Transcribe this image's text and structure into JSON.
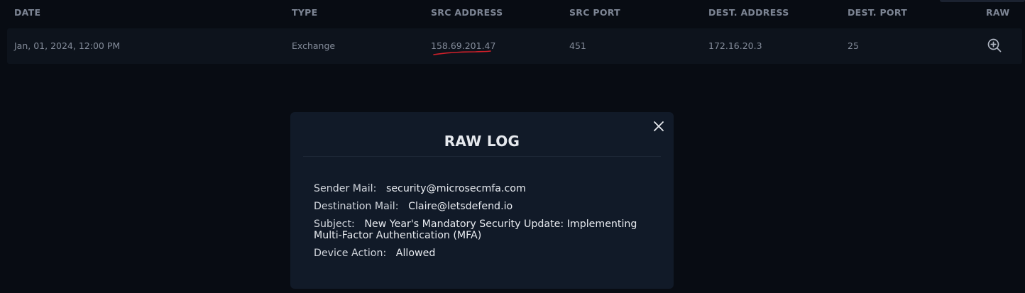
{
  "table": {
    "headers": {
      "date": "DATE",
      "type": "TYPE",
      "src_address": "SRC ADDRESS",
      "src_port": "SRC PORT",
      "dest_address": "DEST. ADDRESS",
      "dest_port": "DEST. PORT",
      "raw": "RAW"
    },
    "rows": [
      {
        "date": "Jan, 01, 2024, 12:00 PM",
        "type": "Exchange",
        "src_address": "158.69.201.47",
        "src_port": "451",
        "dest_address": "172.16.20.3",
        "dest_port": "25",
        "raw_icon": "zoom-in-icon"
      }
    ],
    "annotation_color": "#d0202a"
  },
  "modal": {
    "title": "RAW LOG",
    "close_icon": "close-icon",
    "fields": {
      "sender_label": "Sender Mail:",
      "sender_value": "security@microsecmfa.com",
      "destination_label": "Destination Mail:",
      "destination_value": "Claire@letsdefend.io",
      "subject_label": "Subject:",
      "subject_value": "New Year's Mandatory Security Update: Implementing Multi-Factor Authentication (MFA)",
      "action_label": "Device Action:",
      "action_value": "Allowed"
    }
  },
  "colors": {
    "background": "#080c13",
    "row_background": "#0d131c",
    "modal_background": "#111a28",
    "header_text": "#7d8594"
  }
}
